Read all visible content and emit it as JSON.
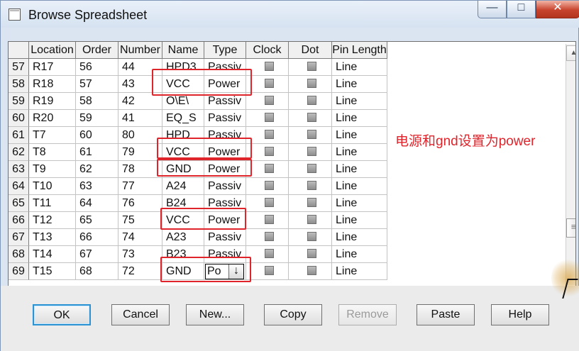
{
  "window": {
    "title": "Browse Spreadsheet",
    "controls": [
      "—",
      "□",
      "✕"
    ]
  },
  "table": {
    "columns": [
      "",
      "Location",
      "Order",
      "Number",
      "Name",
      "Type",
      "Clock",
      "Dot",
      "Pin Length"
    ],
    "rows": [
      {
        "index": "57",
        "location": "R17",
        "order": "56",
        "number": "44",
        "name": "HPD3",
        "type": "Passiv",
        "pin_length": "Line"
      },
      {
        "index": "58",
        "location": "R18",
        "order": "57",
        "number": "43",
        "name": "VCC",
        "type": "Power",
        "pin_length": "Line"
      },
      {
        "index": "59",
        "location": "R19",
        "order": "58",
        "number": "42",
        "name": "O\\E\\",
        "type": "Passiv",
        "pin_length": "Line"
      },
      {
        "index": "60",
        "location": "R20",
        "order": "59",
        "number": "41",
        "name": "EQ_S",
        "type": "Passiv",
        "pin_length": "Line"
      },
      {
        "index": "61",
        "location": "T7",
        "order": "60",
        "number": "80",
        "name": "HPD",
        "type": "Passiv",
        "pin_length": "Line"
      },
      {
        "index": "62",
        "location": "T8",
        "order": "61",
        "number": "79",
        "name": "VCC",
        "type": "Power",
        "pin_length": "Line"
      },
      {
        "index": "63",
        "location": "T9",
        "order": "62",
        "number": "78",
        "name": "GND",
        "type": "Power",
        "pin_length": "Line"
      },
      {
        "index": "64",
        "location": "T10",
        "order": "63",
        "number": "77",
        "name": "A24",
        "type": "Passiv",
        "pin_length": "Line"
      },
      {
        "index": "65",
        "location": "T11",
        "order": "64",
        "number": "76",
        "name": "B24",
        "type": "Passiv",
        "pin_length": "Line"
      },
      {
        "index": "66",
        "location": "T12",
        "order": "65",
        "number": "75",
        "name": "VCC",
        "type": "Power",
        "pin_length": "Line"
      },
      {
        "index": "67",
        "location": "T13",
        "order": "66",
        "number": "74",
        "name": "A23",
        "type": "Passiv",
        "pin_length": "Line"
      },
      {
        "index": "68",
        "location": "T14",
        "order": "67",
        "number": "73",
        "name": "B23",
        "type": "Passiv",
        "pin_length": "Line"
      },
      {
        "index": "69",
        "location": "T15",
        "order": "68",
        "number": "72",
        "name": "GND",
        "type": "Po",
        "pin_length": "Line",
        "editing": true
      }
    ]
  },
  "annotation": {
    "text": "电源和gnd设置为power",
    "color": "#e0242b"
  },
  "buttons": {
    "ok": "OK",
    "cancel": "Cancel",
    "new": "New...",
    "copy": "Copy",
    "remove": "Remove",
    "paste": "Paste",
    "help": "Help"
  },
  "icons": {
    "dropdown": "↓",
    "scroll_up": "▲",
    "scroll_thumb": "≡"
  }
}
